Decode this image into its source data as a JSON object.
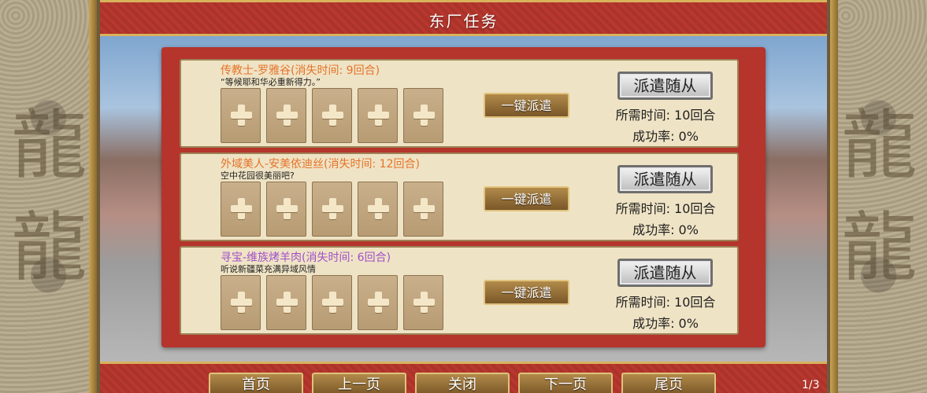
{
  "header": {
    "title": "东厂任务"
  },
  "tasks": [
    {
      "title": "传教士-罗雅谷(消失时间: 9回合)",
      "title_color": "#e5732a",
      "desc": "“等候耶和华必重新得力。”",
      "one_click": "一键派遣",
      "dispatch": "派遣随从",
      "time": "所需时间: 10回合",
      "rate": "成功率: 0%",
      "slot_icon": "plus-icon"
    },
    {
      "title": "外域美人-安美依迪丝(消失时间: 12回合)",
      "title_color": "#e5732a",
      "desc": "空中花园很美丽吧?",
      "one_click": "一键派遣",
      "dispatch": "派遣随从",
      "time": "所需时间: 10回合",
      "rate": "成功率: 0%",
      "slot_icon": "plus-icon"
    },
    {
      "title": "寻宝-维族烤羊肉(消失时间: 6回合)",
      "title_color": "#a050c8",
      "desc": "听说新疆菜充满异域风情",
      "one_click": "一键派遣",
      "dispatch": "派遣随从",
      "time": "所需时间: 10回合",
      "rate": "成功率: 0%",
      "slot_icon": "plus-icon"
    }
  ],
  "footer": {
    "first": "首页",
    "prev": "上一页",
    "close": "关闭",
    "next": "下一页",
    "last": "尾页",
    "page": "1/3"
  },
  "decor": {
    "side_icon": "dragon-icon"
  }
}
